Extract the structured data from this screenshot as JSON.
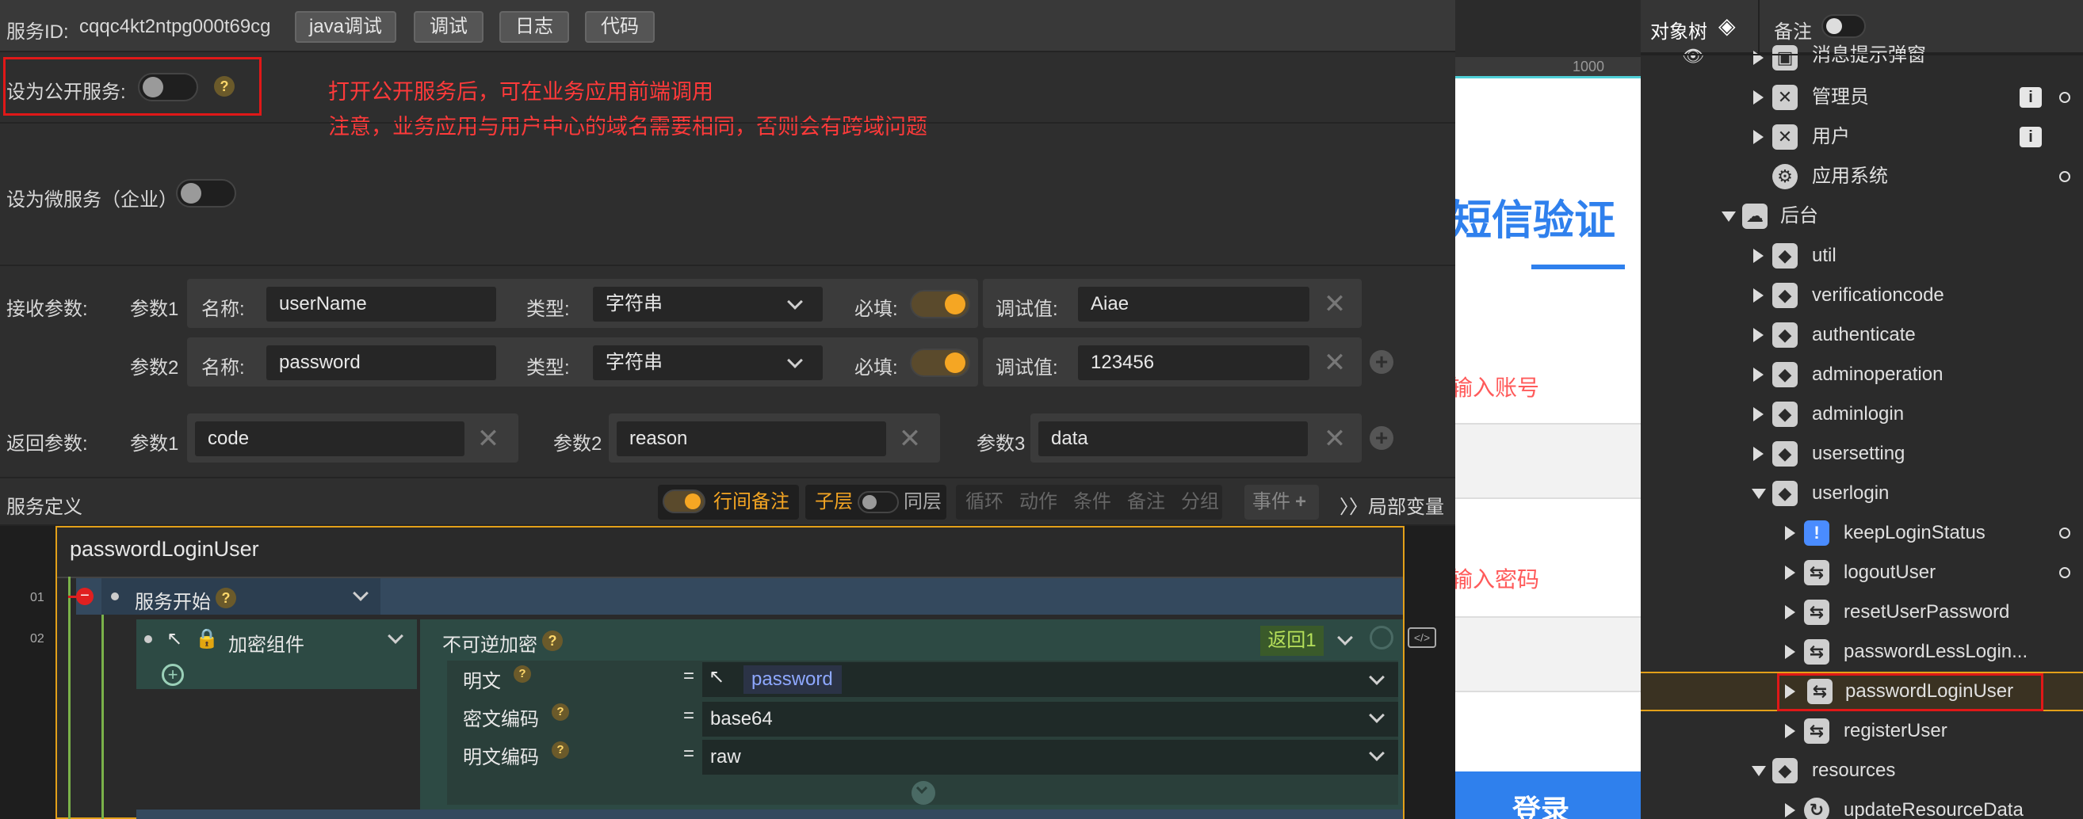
{
  "header": {
    "service_id_label": "服务ID:",
    "service_id": "cqqc4kt2ntpg000t69cg",
    "buttons": [
      "java调试",
      "调试",
      "日志",
      "代码"
    ]
  },
  "public_service": {
    "label": "设为公开服务:",
    "help": "?",
    "note_line1": "打开公开服务后，可在业务应用前端调用",
    "note_line2": "注意，业务应用与用户中心的域名需要相同，否则会有跨域问题"
  },
  "micro_service": {
    "label": "设为微服务（企业）"
  },
  "receive_params": {
    "label": "接收参数:",
    "rows": [
      {
        "param": "参数1",
        "name_label": "名称:",
        "name": "userName",
        "type_label": "类型:",
        "type": "字符串",
        "required_label": "必填:",
        "debug_label": "调试值:",
        "debug_value": "Aiae"
      },
      {
        "param": "参数2",
        "name_label": "名称:",
        "name": "password",
        "type_label": "类型:",
        "type": "字符串",
        "required_label": "必填:",
        "debug_label": "调试值:",
        "debug_value": "123456"
      }
    ]
  },
  "return_params": {
    "label": "返回参数:",
    "items": [
      {
        "param": "参数1",
        "value": "code"
      },
      {
        "param": "参数2",
        "value": "reason"
      },
      {
        "param": "参数3",
        "value": "data"
      }
    ]
  },
  "service_def": {
    "label": "服务定义",
    "inline_note": "行间备注",
    "child_layer": "子层",
    "same_layer": "同层",
    "tabs": [
      "循环",
      "动作",
      "条件",
      "备注",
      "分组"
    ],
    "event": "事件",
    "local_vars": "局部变量"
  },
  "flow": {
    "name": "passwordLoginUser",
    "line1": "01",
    "line2": "02",
    "start_label": "服务开始",
    "component": "加密组件",
    "method": "不可逆加密",
    "return_label": "返回1",
    "fields": [
      {
        "label": "明文",
        "eq": "=",
        "value": "password"
      },
      {
        "label": "密文编码",
        "eq": "=",
        "value": "base64"
      },
      {
        "label": "明文编码",
        "eq": "=",
        "value": "raw"
      }
    ]
  },
  "preview": {
    "ruler": "1000",
    "title": "短信验证",
    "account_placeholder": "输入账号",
    "password_placeholder": "输入密码",
    "login": "登录"
  },
  "tree": {
    "header_tab1": "对象树",
    "header_tab2": "备注",
    "items": [
      {
        "label": "消息提示弹窗",
        "icon": "image-icon"
      },
      {
        "label": "管理员",
        "icon": "cross-box-icon"
      },
      {
        "label": "用户",
        "icon": "cross-box-icon"
      },
      {
        "label": "应用系统",
        "icon": "gear-icon"
      },
      {
        "label": "后台",
        "icon": "cloud-stack-icon"
      },
      {
        "label": "util",
        "icon": "cube-icon"
      },
      {
        "label": "verificationcode",
        "icon": "cube-icon"
      },
      {
        "label": "authenticate",
        "icon": "cube-icon"
      },
      {
        "label": "adminoperation",
        "icon": "cube-icon"
      },
      {
        "label": "adminlogin",
        "icon": "cube-icon"
      },
      {
        "label": "usersetting",
        "icon": "cube-icon"
      },
      {
        "label": "userlogin",
        "icon": "cube-icon"
      },
      {
        "label": "keepLoginStatus",
        "icon": "chat-icon"
      },
      {
        "label": "logoutUser",
        "icon": "swap-icon"
      },
      {
        "label": "resetUserPassword",
        "icon": "swap-icon"
      },
      {
        "label": "passwordLessLogin...",
        "icon": "swap-icon"
      },
      {
        "label": "passwordLoginUser",
        "icon": "swap-icon"
      },
      {
        "label": "registerUser",
        "icon": "swap-icon"
      },
      {
        "label": "resources",
        "icon": "cube-icon"
      },
      {
        "label": "updateResourceData",
        "icon": "refresh-icon"
      }
    ]
  }
}
